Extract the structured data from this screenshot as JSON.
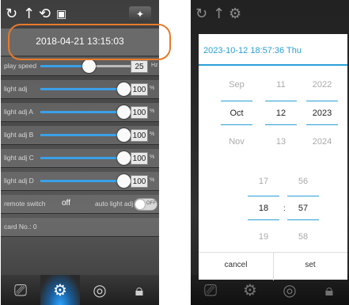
{
  "left": {
    "icons": [
      "sync-icon",
      "upload-arrow-icon",
      "refresh-icon",
      "camera-icon",
      "magic-wand-icon"
    ],
    "datetime": "2018-04-21 13:15:03",
    "play_speed": {
      "label": "play speed",
      "value": "25",
      "unit": "Hz",
      "fraction": 0.3
    },
    "light_rows": [
      {
        "label": "light adj",
        "value": "100",
        "unit": "%"
      },
      {
        "label": "light adj A",
        "value": "100",
        "unit": "%"
      },
      {
        "label": "light adj B",
        "value": "100",
        "unit": "%"
      },
      {
        "label": "light adj C",
        "value": "100",
        "unit": "%"
      },
      {
        "label": "light adj D",
        "value": "100",
        "unit": "%"
      }
    ],
    "remote_switch": {
      "label": "remote switch",
      "value": "off",
      "auto_label": "auto light adj",
      "toggle_text": "OFF"
    },
    "card_no": "card No.:  0",
    "nav": [
      "tv-icon",
      "settings-gear-icon",
      "disc-icon",
      "lock-icon"
    ],
    "accent": "#e87a2a"
  },
  "right": {
    "header": "2023-10-12 18:57:36 Thu",
    "date_cols": {
      "month": [
        "Sep",
        "Oct",
        "Nov"
      ],
      "day": [
        "11",
        "12",
        "13"
      ],
      "year": [
        "2022",
        "2023",
        "2024"
      ]
    },
    "time_cols": {
      "hour": [
        "17",
        "18",
        "19"
      ],
      "minute": [
        "56",
        "57",
        "58"
      ],
      "sep": ":"
    },
    "cancel": "cancel",
    "set": "set",
    "accent": "#2a9fd6"
  }
}
